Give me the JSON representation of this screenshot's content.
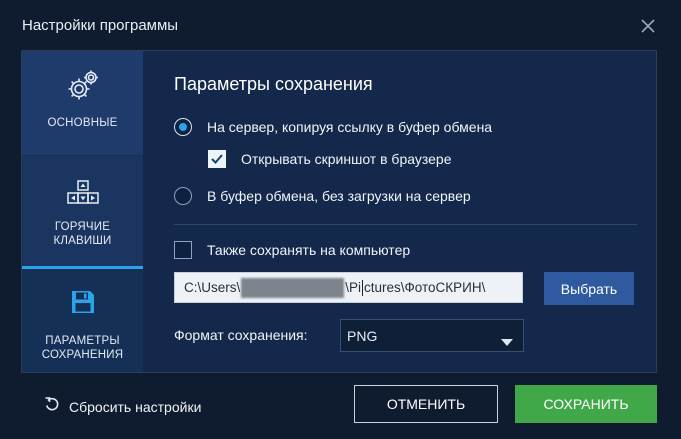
{
  "window": {
    "title": "Настройки программы"
  },
  "sidebar": {
    "items": [
      {
        "label": "ОСНОВНЫЕ",
        "icon": "gears-icon"
      },
      {
        "label_line1": "ГОРЯЧИЕ",
        "label_line2": "КЛАВИШИ",
        "icon": "keyboard-icon",
        "active": true
      },
      {
        "label_line1": "ПАРАМЕТРЫ",
        "label_line2": "СОХРАНЕНИЯ",
        "icon": "floppy-disk-icon"
      }
    ]
  },
  "main": {
    "section_title": "Параметры сохранения",
    "option_server": {
      "label": "На сервер, копируя ссылку в буфер обмена",
      "checked": true
    },
    "option_open_browser": {
      "label": "Открывать скриншот в браузере",
      "checked": true
    },
    "option_clipboard": {
      "label": "В буфер обмена, без загрузки на сервер",
      "checked": false
    },
    "option_save_pc": {
      "label": "Также сохранять на компьютер",
      "checked": false
    },
    "path": {
      "prefix": "C:\\Users\\",
      "middle": "\\Pi",
      "suffix": "ctures\\ФотоСКРИН\\"
    },
    "browse_label": "Выбрать",
    "format_label": "Формат сохранения:",
    "format_value": "PNG"
  },
  "footer": {
    "reset_label": "Сбросить настройки",
    "cancel_label": "ОТМЕНИТЬ",
    "save_label": "СОХРАНИТЬ"
  },
  "colors": {
    "background": "#0f1b2e",
    "panel": "#13284a",
    "sidebar": "#1b3561",
    "accent": "#2aa3ea",
    "save_button": "#41a84a",
    "browse_button": "#2f5aa0"
  }
}
